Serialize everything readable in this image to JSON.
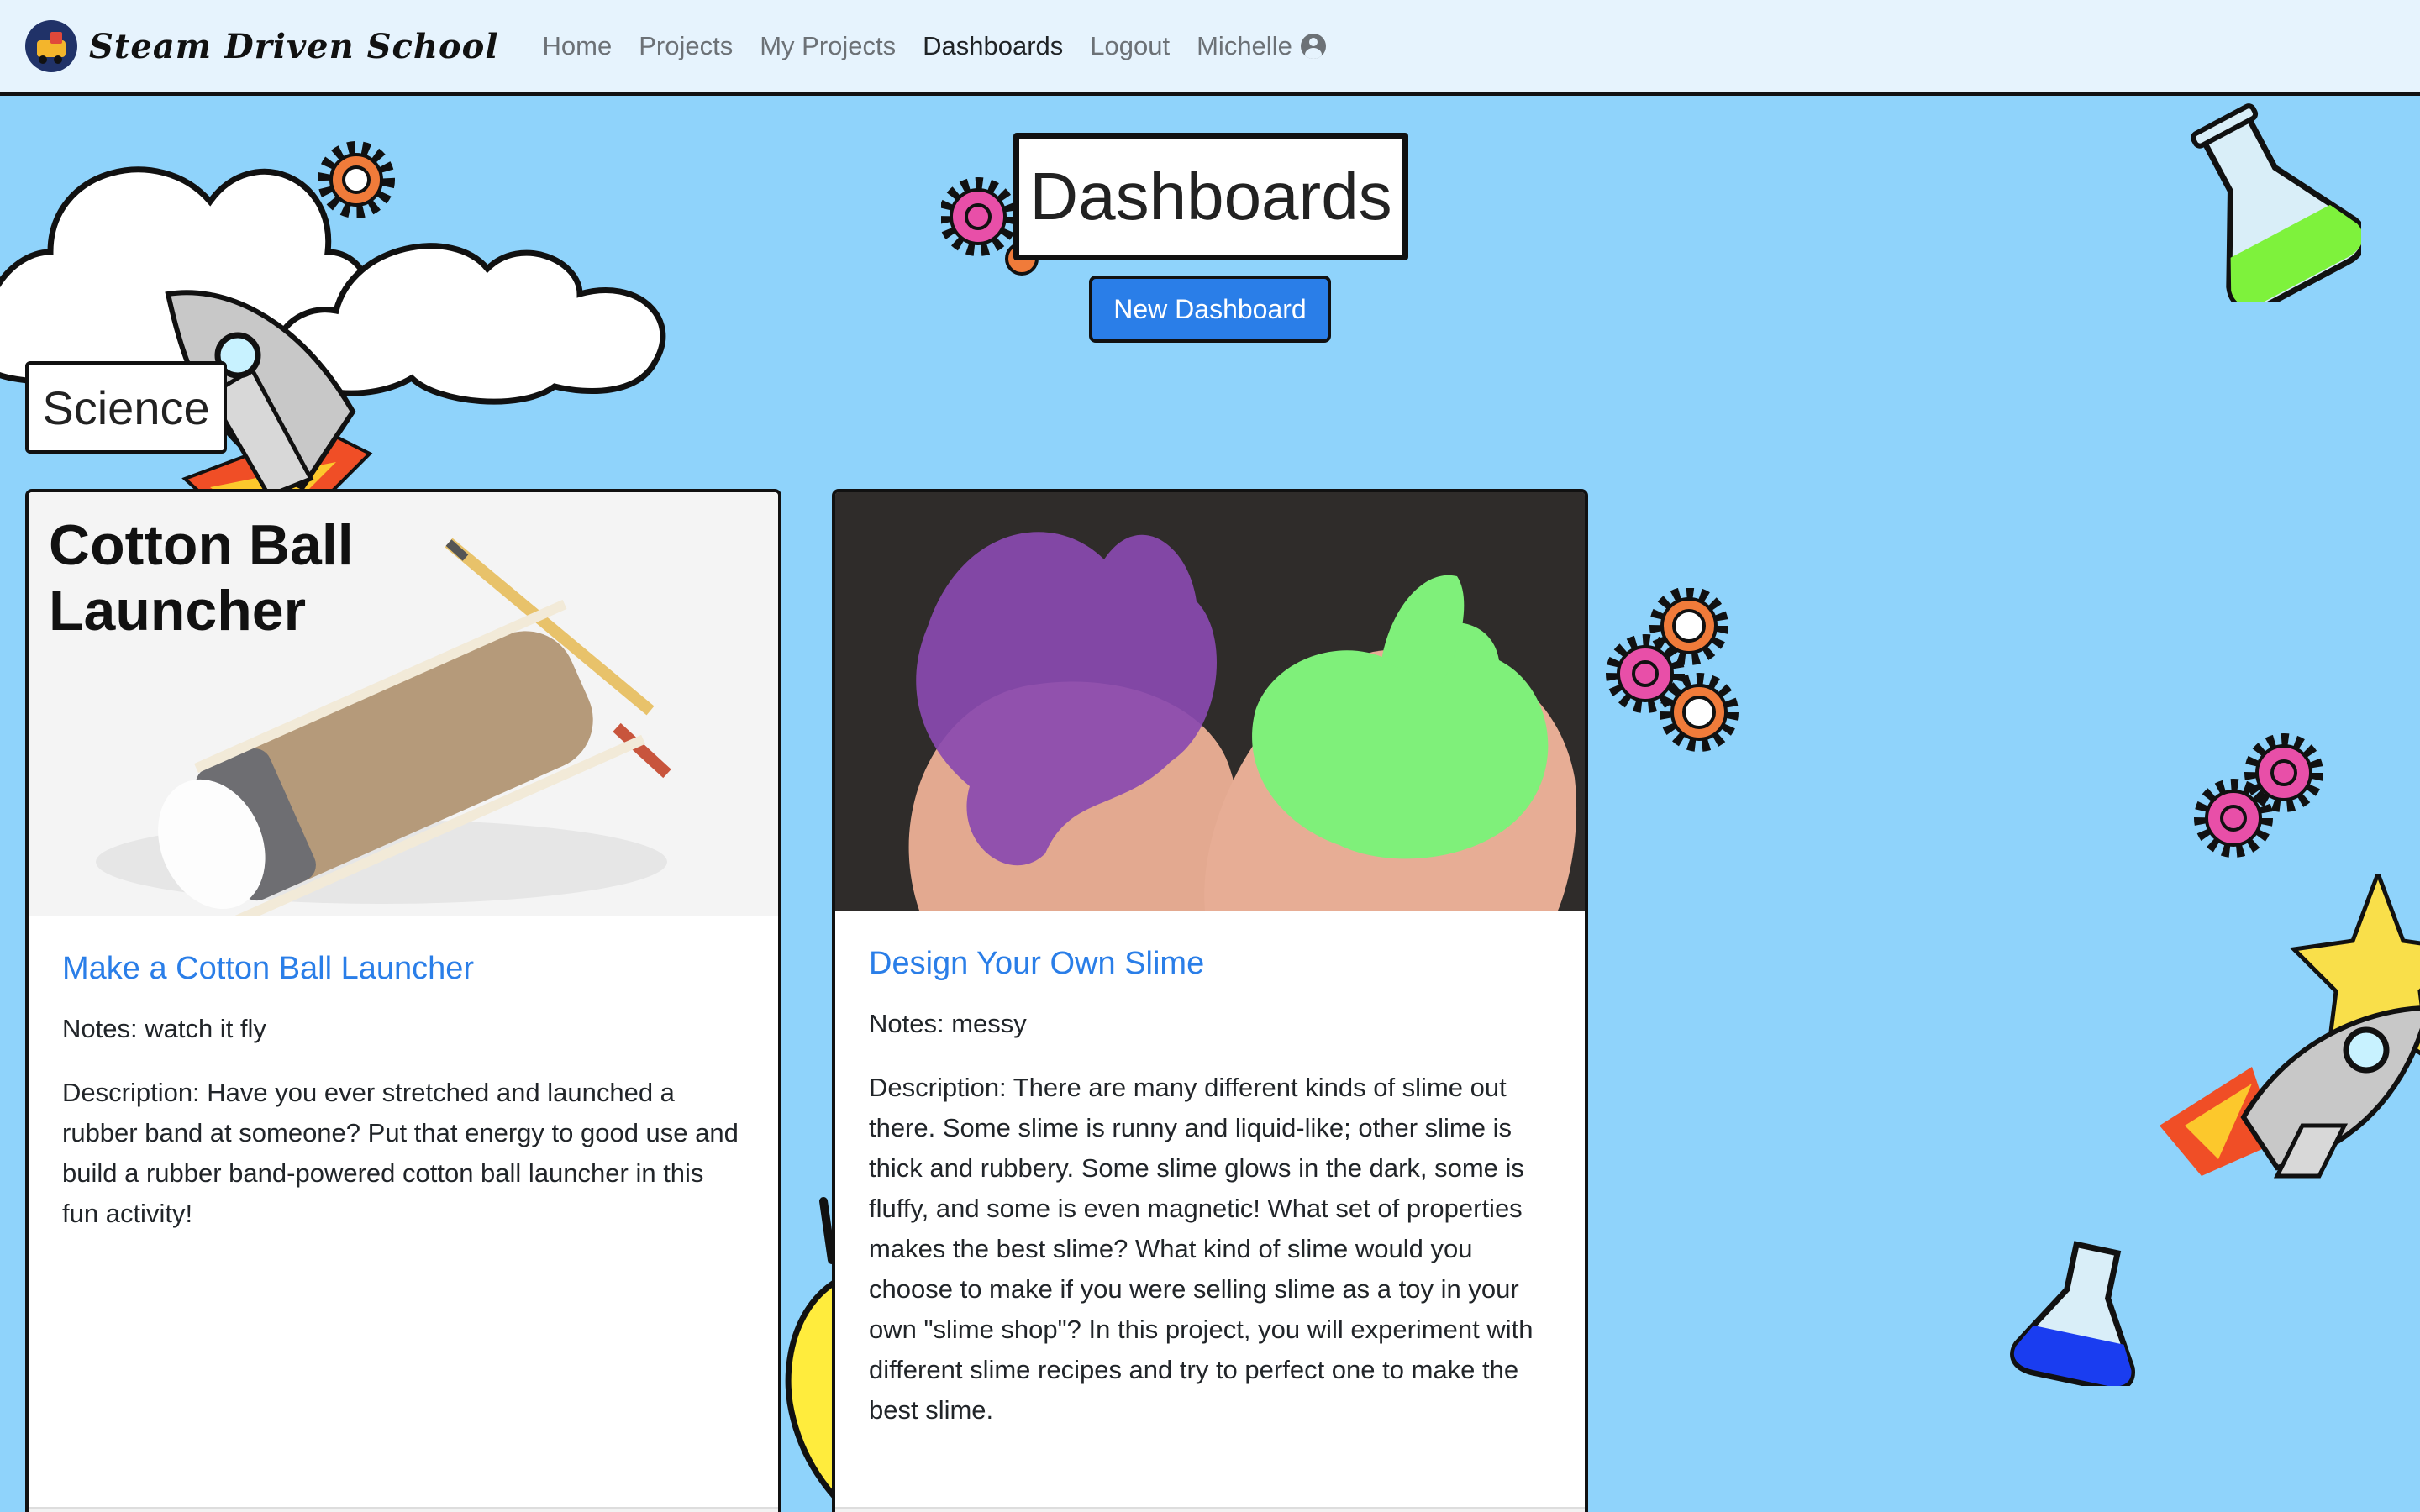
{
  "nav": {
    "brand": "Steam Driven School",
    "links": [
      "Home",
      "Projects",
      "My Projects",
      "Dashboards",
      "Logout"
    ],
    "user": "Michelle"
  },
  "page": {
    "title": "Dashboards",
    "new_button": "New Dashboard"
  },
  "category": "Science",
  "cards": [
    {
      "image_caption": "Cotton Ball Launcher",
      "title": "Make a Cotton Ball Launcher",
      "notes": "Notes: watch it fly",
      "description": "Description: Have you ever stretched and launched a rubber band at someone? Put that energy to good use and build a rubber band-powered cotton ball launcher in this fun activity!"
    },
    {
      "title": "Design Your Own Slime",
      "notes": "Notes: messy",
      "description": "Description: There are many different kinds of slime out there. Some slime is runny and liquid-like; other slime is thick and rubbery. Some slime glows in the dark, some is fluffy, and some is even magnetic! What set of properties makes the best slime? What kind of slime would you choose to make if you were selling slime as a toy in your own \"slime shop\"? In this project, you will experiment with different slime recipes and try to perfect one to make the best slime."
    }
  ],
  "colors": {
    "background": "#8fd3fb",
    "navbar": "#e6f3fd",
    "primary": "#2a7ee8",
    "gear_orange": "#f07b3a",
    "gear_pink": "#e84fa8"
  }
}
